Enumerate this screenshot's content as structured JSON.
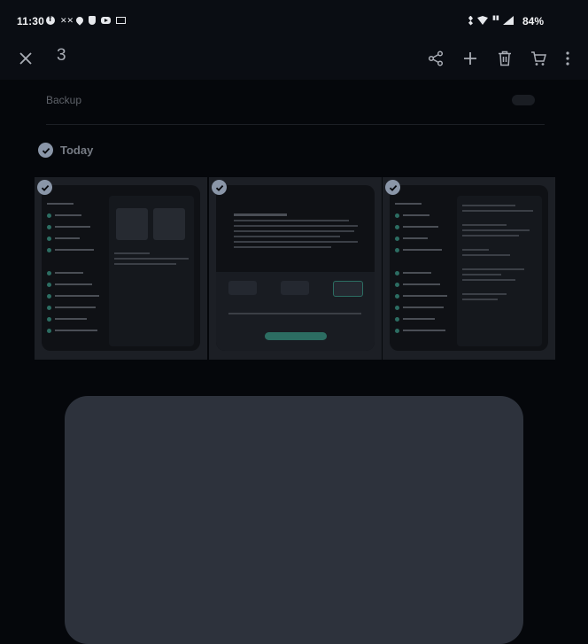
{
  "status_bar": {
    "time": "11:30",
    "battery": "84%",
    "left_icons": [
      "facebook-icon",
      "xx-icon",
      "drop-icon",
      "shield-icon",
      "youtube-icon",
      "mail-icon"
    ],
    "right_icons": [
      "bluetooth-icon",
      "wifi-icon",
      "network-icon",
      "signal-icon"
    ]
  },
  "toolbar": {
    "selected_count": "3",
    "actions": [
      "share-icon",
      "add-icon",
      "delete-icon",
      "cart-icon",
      "more-icon"
    ]
  },
  "backup": {
    "label": "Backup"
  },
  "section": {
    "label": "Today"
  },
  "thumbnails": [
    {
      "name": "settings-screenshot"
    },
    {
      "name": "font-screenshot"
    },
    {
      "name": "display-screenshot"
    }
  ],
  "colors": {
    "background": "#05070b",
    "card": "#2d323c",
    "check": "#8a96a8"
  }
}
